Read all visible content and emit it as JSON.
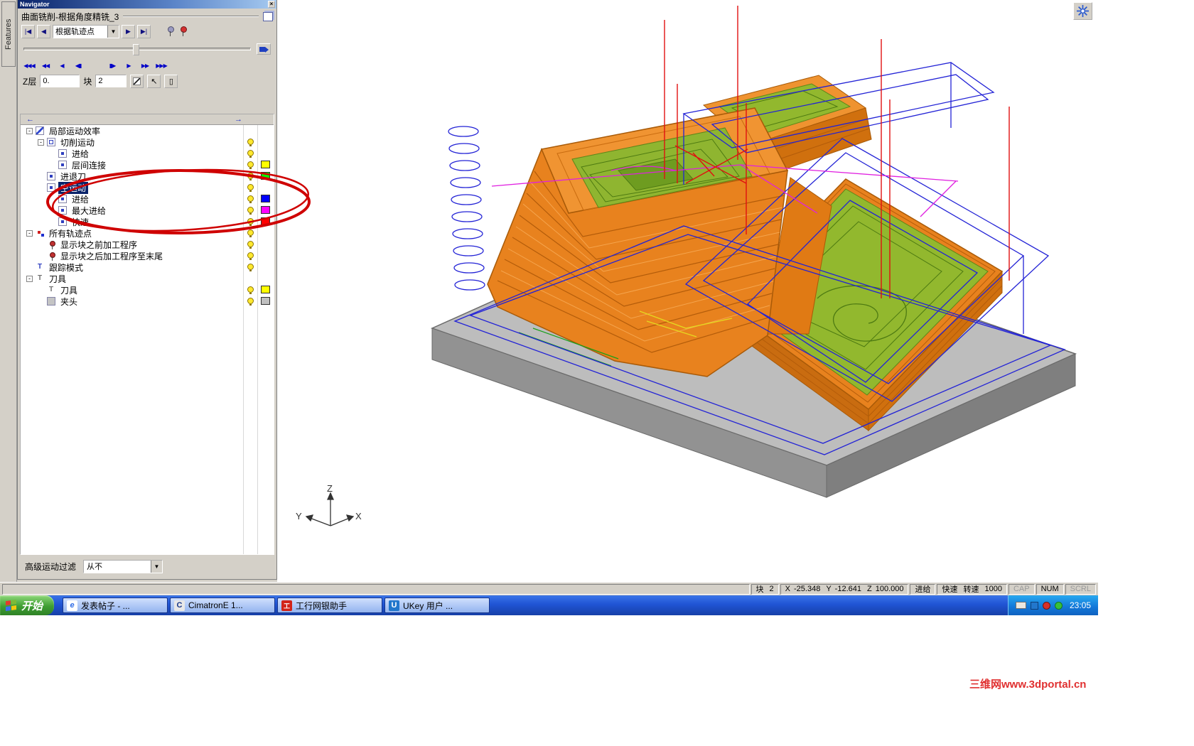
{
  "features_tab": {
    "label": "Features"
  },
  "navigator": {
    "title": "Navigator",
    "close": "×",
    "operation_name": "曲面铣削-根据角度精铣_3",
    "transport": {
      "first": "|◀",
      "prev": "◀",
      "mode_value": "根据轨迹点",
      "dropdown_arrow": "▼",
      "play": "▶",
      "last": "▶|"
    },
    "vcr": {
      "left": [
        "◀◀◀",
        "◀◀",
        "◀",
        "◀▮"
      ],
      "right": [
        "▮▶",
        "▶",
        "▶▶",
        "▶▶▶"
      ]
    },
    "fields": {
      "z_label": "Z层",
      "z_value": "0.",
      "block_label": "块",
      "block_value": "2",
      "cursor_glyph": "↖"
    },
    "tree_head": {
      "left_arrow": "←",
      "right_arrow": "→"
    },
    "tree": [
      {
        "level": 0,
        "expander": "-",
        "icon": "chart",
        "label": "局部运动效率"
      },
      {
        "level": 1,
        "expander": "-",
        "icon": "motion",
        "label": "切削运动",
        "bulb": true
      },
      {
        "level": 2,
        "icon": "node",
        "label": "进给",
        "bulb": true
      },
      {
        "level": 2,
        "icon": "node",
        "label": "层间连接",
        "bulb": true,
        "swatch": "#ffff00"
      },
      {
        "level": 1,
        "icon": "node",
        "label": "进退刀",
        "bulb": true,
        "swatch": "#00ff00"
      },
      {
        "level": 1,
        "icon": "node",
        "label": "空运动",
        "bulb": true,
        "selected": true
      },
      {
        "level": 2,
        "icon": "node",
        "label": "进给",
        "bulb": true,
        "swatch": "#0000ff"
      },
      {
        "level": 2,
        "icon": "node",
        "label": "最大进给",
        "bulb": true,
        "swatch": "#ff00ff"
      },
      {
        "level": 2,
        "icon": "node",
        "label": "快速",
        "bulb": true,
        "swatch": "#ff0000"
      },
      {
        "level": 0,
        "expander": "-",
        "icon": "points",
        "label": "所有轨迹点",
        "bulb": true
      },
      {
        "level": 1,
        "icon": "pin-i",
        "label": "显示块之前加工程序",
        "bulb": true
      },
      {
        "level": 1,
        "icon": "pin-i",
        "label": "显示块之后加工程序至末尾",
        "bulb": true
      },
      {
        "level": 0,
        "icon": "trace",
        "label": "跟踪模式",
        "bulb": true
      },
      {
        "level": 0,
        "expander": "-",
        "icon": "tool",
        "label": "刀具"
      },
      {
        "level": 1,
        "icon": "tool",
        "label": "刀具",
        "bulb": true,
        "swatch": "#ffff00"
      },
      {
        "level": 1,
        "icon": "holder",
        "label": "夹头",
        "bulb": true,
        "swatch": "#c0c0c0"
      }
    ],
    "filter": {
      "label": "高级运动过滤",
      "value": "从不",
      "dropdown_arrow": "▼"
    }
  },
  "viewport": {
    "axis_x": "X",
    "axis_y": "Y",
    "axis_z": "Z"
  },
  "status": {
    "block_label": "块",
    "block_value": "2",
    "x_label": "X",
    "x_value": "-25.348",
    "y_label": "Y",
    "y_value": "-12.641",
    "z_label": "Z",
    "z_value": "100.000",
    "feed": "进给",
    "rapid": "快速",
    "spindle_label": "转速",
    "spindle_value": "1000",
    "cap": "CAP",
    "num": "NUM",
    "scrl": "SCRL"
  },
  "taskbar": {
    "start": "开始",
    "tasks": [
      {
        "label": "发表帖子 - ...",
        "icon": "ie-icon"
      },
      {
        "label": "CimatronE 1...",
        "icon": "cimatron-icon"
      },
      {
        "label": "工行网银助手",
        "icon": "icbc-icon"
      },
      {
        "label": "UKey 用户 ...",
        "icon": "ukey-icon"
      }
    ],
    "clock": "23:05"
  },
  "watermark": "三维网www.3dportal.cn",
  "colors": {
    "selection": "#0a246a",
    "toolpath_blue": "#2323d6",
    "toolpath_magenta": "#e020e0",
    "toolpath_red": "#e01010",
    "toolpath_yellow": "#e6d820",
    "part_orange": "#e8821e",
    "part_green": "#92b82e",
    "stock_gray": "#bdbdbd"
  }
}
